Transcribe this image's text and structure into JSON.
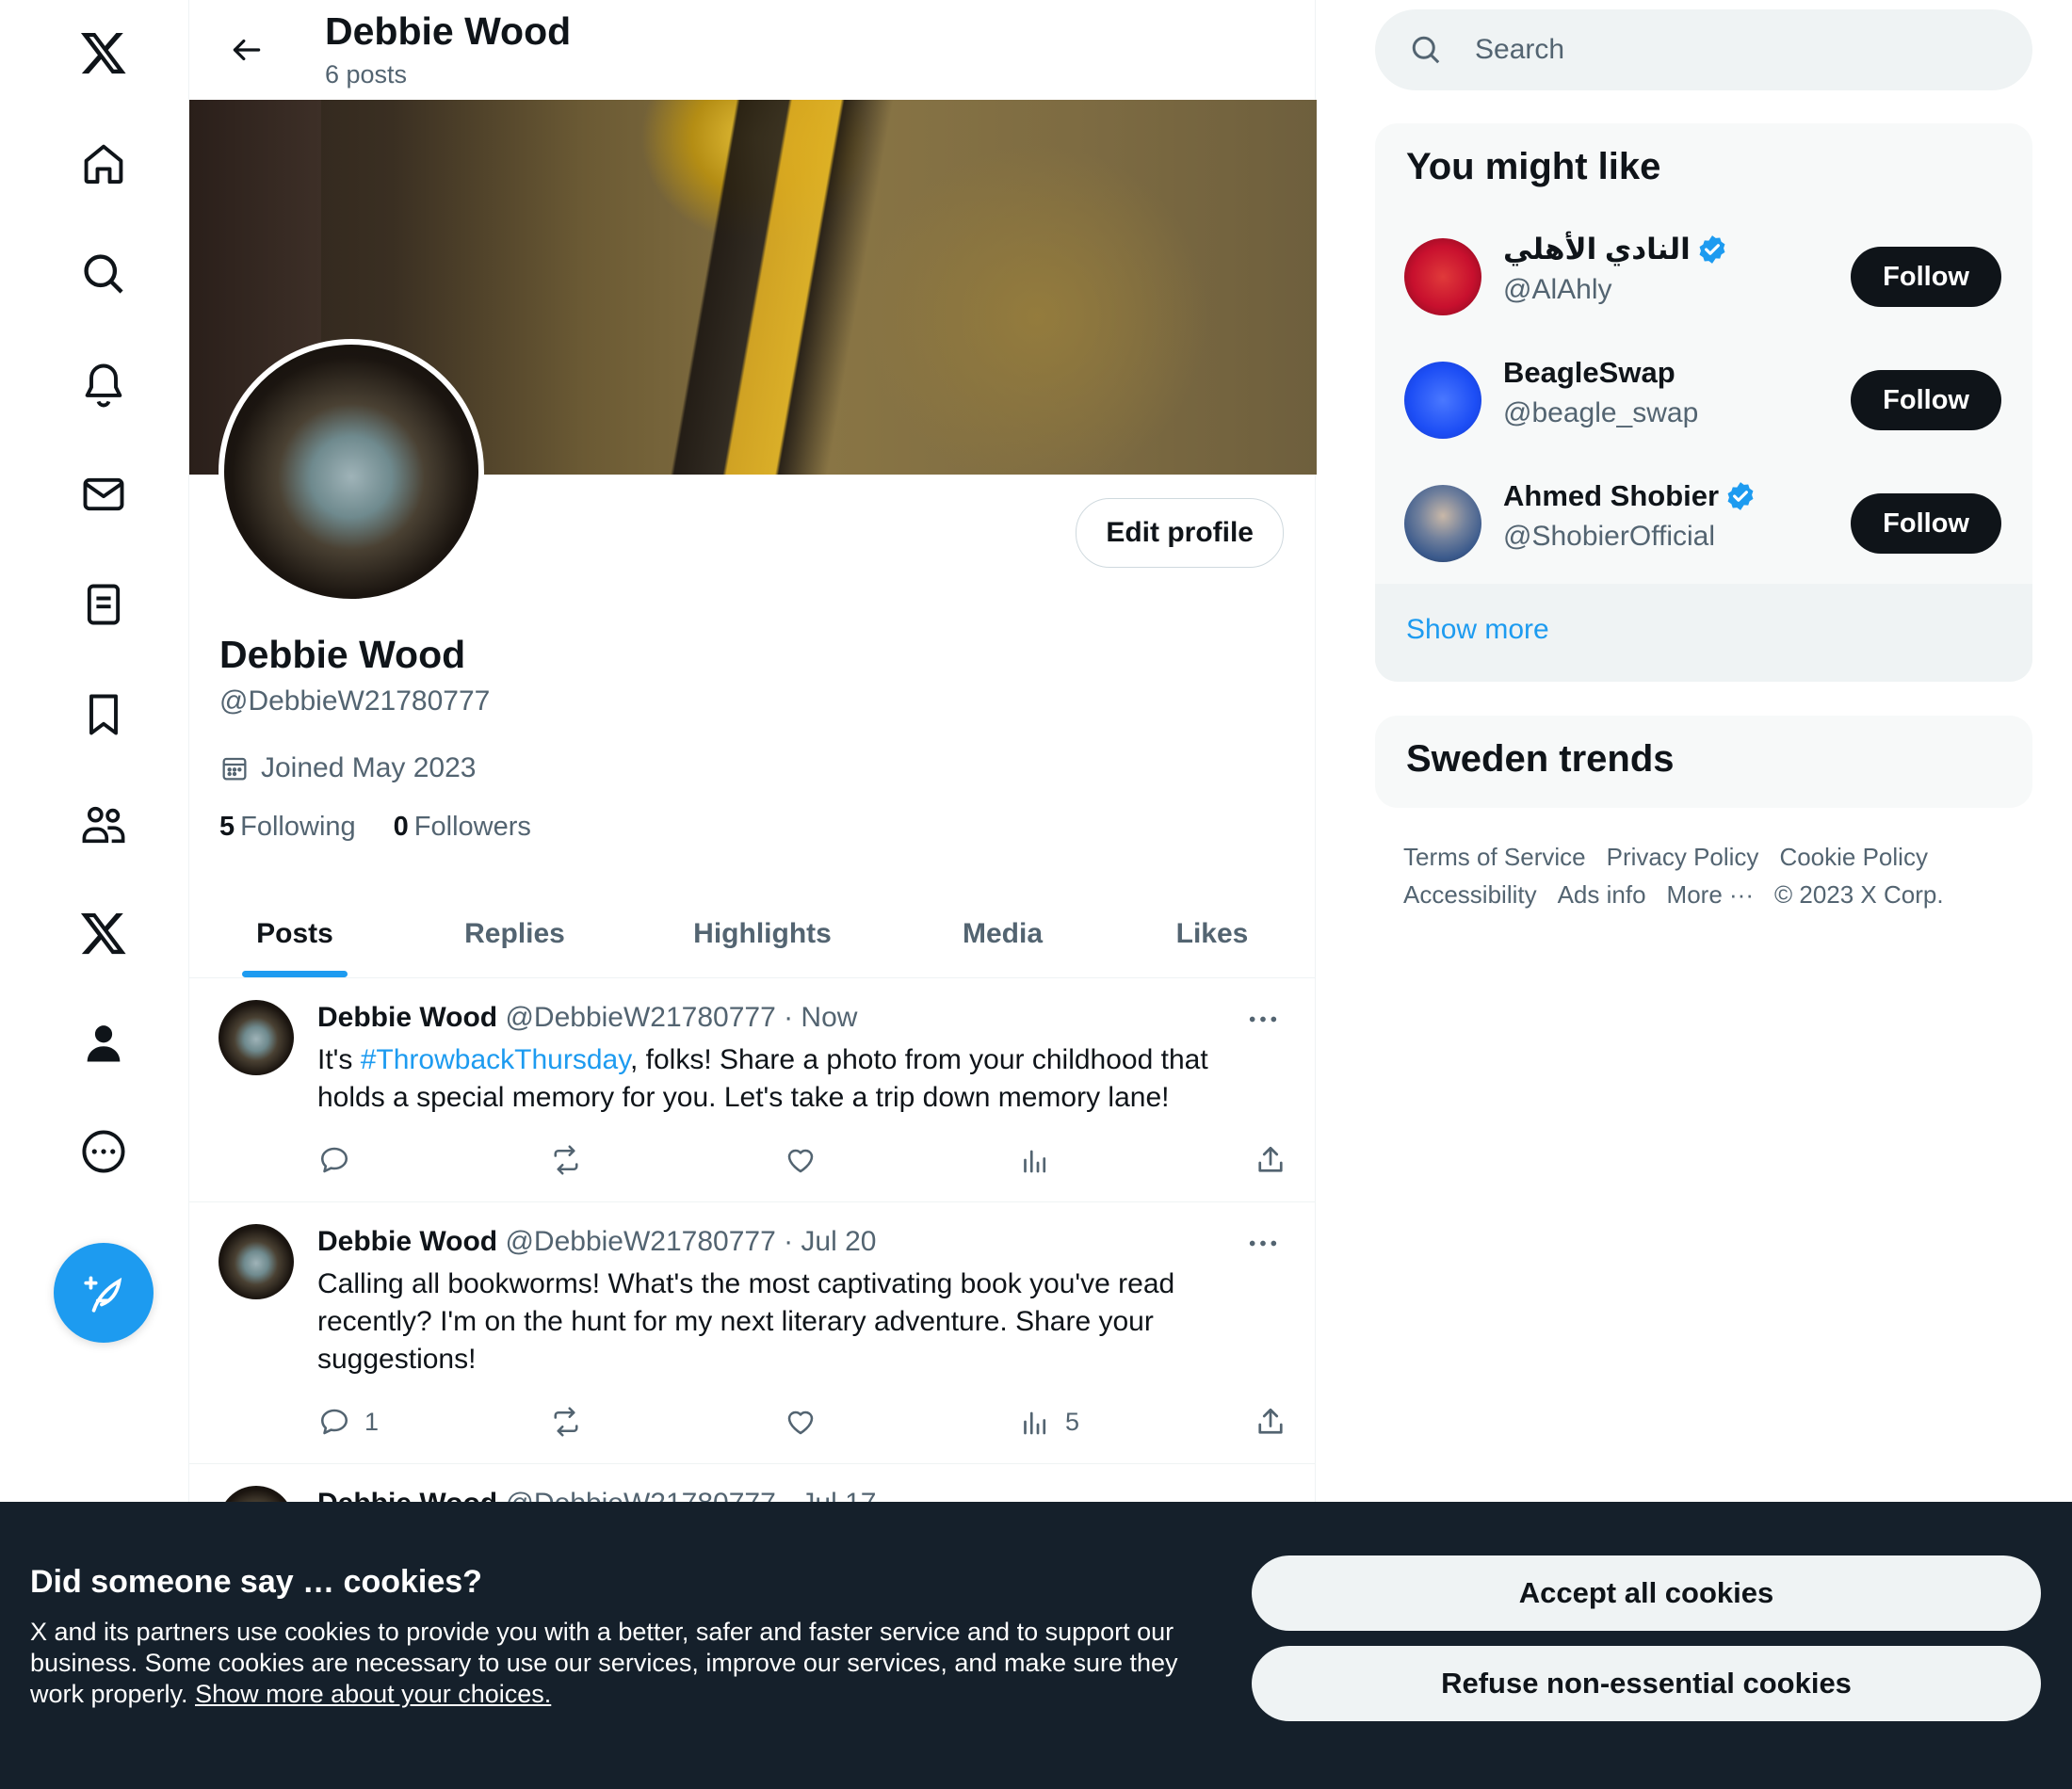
{
  "nav": {
    "items": [
      "x-logo",
      "home",
      "explore",
      "notifications",
      "messages",
      "lists",
      "bookmarks",
      "communities",
      "premium",
      "profile",
      "more"
    ]
  },
  "header": {
    "name": "Debbie Wood",
    "post_count": "6 posts"
  },
  "profile": {
    "edit_label": "Edit profile",
    "name": "Debbie Wood",
    "handle": "@DebbieW21780777",
    "joined": "Joined May 2023",
    "following_count": "5",
    "following_label": "Following",
    "followers_count": "0",
    "followers_label": "Followers"
  },
  "tabs": [
    "Posts",
    "Replies",
    "Highlights",
    "Media",
    "Likes"
  ],
  "posts": [
    {
      "name": "Debbie Wood",
      "meta": "@DebbieW21780777 · Now",
      "text_before": "It's ",
      "hashtag": "#ThrowbackThursday",
      "text_after": ", folks! Share a photo from your childhood that holds a special memory for you. Let's take a trip down memory lane!",
      "replies": "",
      "views": ""
    },
    {
      "name": "Debbie Wood",
      "meta": "@DebbieW21780777 · Jul 20",
      "text": "Calling all bookworms! What's the most captivating book you've read recently? I'm on the hunt for my next literary adventure. Share your suggestions!",
      "replies": "1",
      "views": "5"
    },
    {
      "name": "Debbie Wood",
      "meta": "@DebbieW21780777 · Jul 17"
    }
  ],
  "search": {
    "placeholder": "Search"
  },
  "you_might_like": {
    "title": "You might like",
    "accounts": [
      {
        "name": "النادي الأهلي",
        "handle": "@AlAhly",
        "verified": true,
        "follow": "Follow",
        "avatar_color": "#c8102e"
      },
      {
        "name": "BeagleSwap",
        "handle": "@beagle_swap",
        "verified": false,
        "follow": "Follow",
        "avatar_color": "#1d4ef5"
      },
      {
        "name": "Ahmed Shobier",
        "handle": "@ShobierOfficial",
        "verified": true,
        "follow": "Follow",
        "avatar_color": "#3b5a8c"
      }
    ],
    "show_more": "Show more"
  },
  "trends": {
    "title": "Sweden trends"
  },
  "footer": {
    "links": [
      "Terms of Service",
      "Privacy Policy",
      "Cookie Policy",
      "Accessibility",
      "Ads info",
      "More ···",
      "© 2023 X Corp."
    ]
  },
  "cookie": {
    "title": "Did someone say … cookies?",
    "body": "X and its partners use cookies to provide you with a better, safer and faster service and to support our business. Some cookies are necessary to use our services, improve our services, and make sure they work properly. ",
    "link": "Show more about your choices.",
    "accept": "Accept all cookies",
    "refuse": "Refuse non-essential cookies"
  },
  "colors": {
    "accent": "#1d9bf0",
    "text": "#0f1419",
    "muted": "#536471",
    "cookie_bg": "#15202b"
  }
}
